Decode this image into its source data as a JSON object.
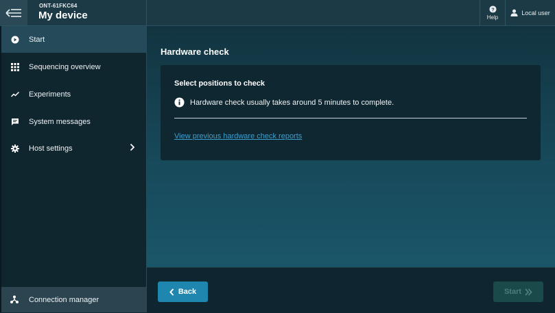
{
  "header": {
    "device_id": "ONT-61FKC64",
    "device_name": "My device",
    "help_label": "Help",
    "user_label": "Local user",
    "menu_icon": "menu-back-icon"
  },
  "sidebar": {
    "items": [
      {
        "label": "Start",
        "icon": "play-circle-icon",
        "selected": true
      },
      {
        "label": "Sequencing overview",
        "icon": "grid-icon"
      },
      {
        "label": "Experiments",
        "icon": "trend-line-icon"
      },
      {
        "label": "System messages",
        "icon": "chat-icon"
      },
      {
        "label": "Host settings",
        "icon": "gear-icon",
        "has_submenu": true
      }
    ],
    "footer_item": {
      "label": "Connection manager",
      "icon": "network-icon"
    }
  },
  "main": {
    "title": "Hardware check",
    "card": {
      "title": "Select positions to check",
      "info_text": "Hardware check usually takes around 5 minutes to complete.",
      "link_text": "View previous hardware check reports"
    }
  },
  "footer": {
    "back_label": "Back",
    "start_label": "Start",
    "start_enabled": false
  },
  "colors": {
    "accent": "#1f86b0",
    "link": "#3f9fcd",
    "sidebar_selected": "#254a59",
    "disabled_button": "#1a4a4a"
  }
}
